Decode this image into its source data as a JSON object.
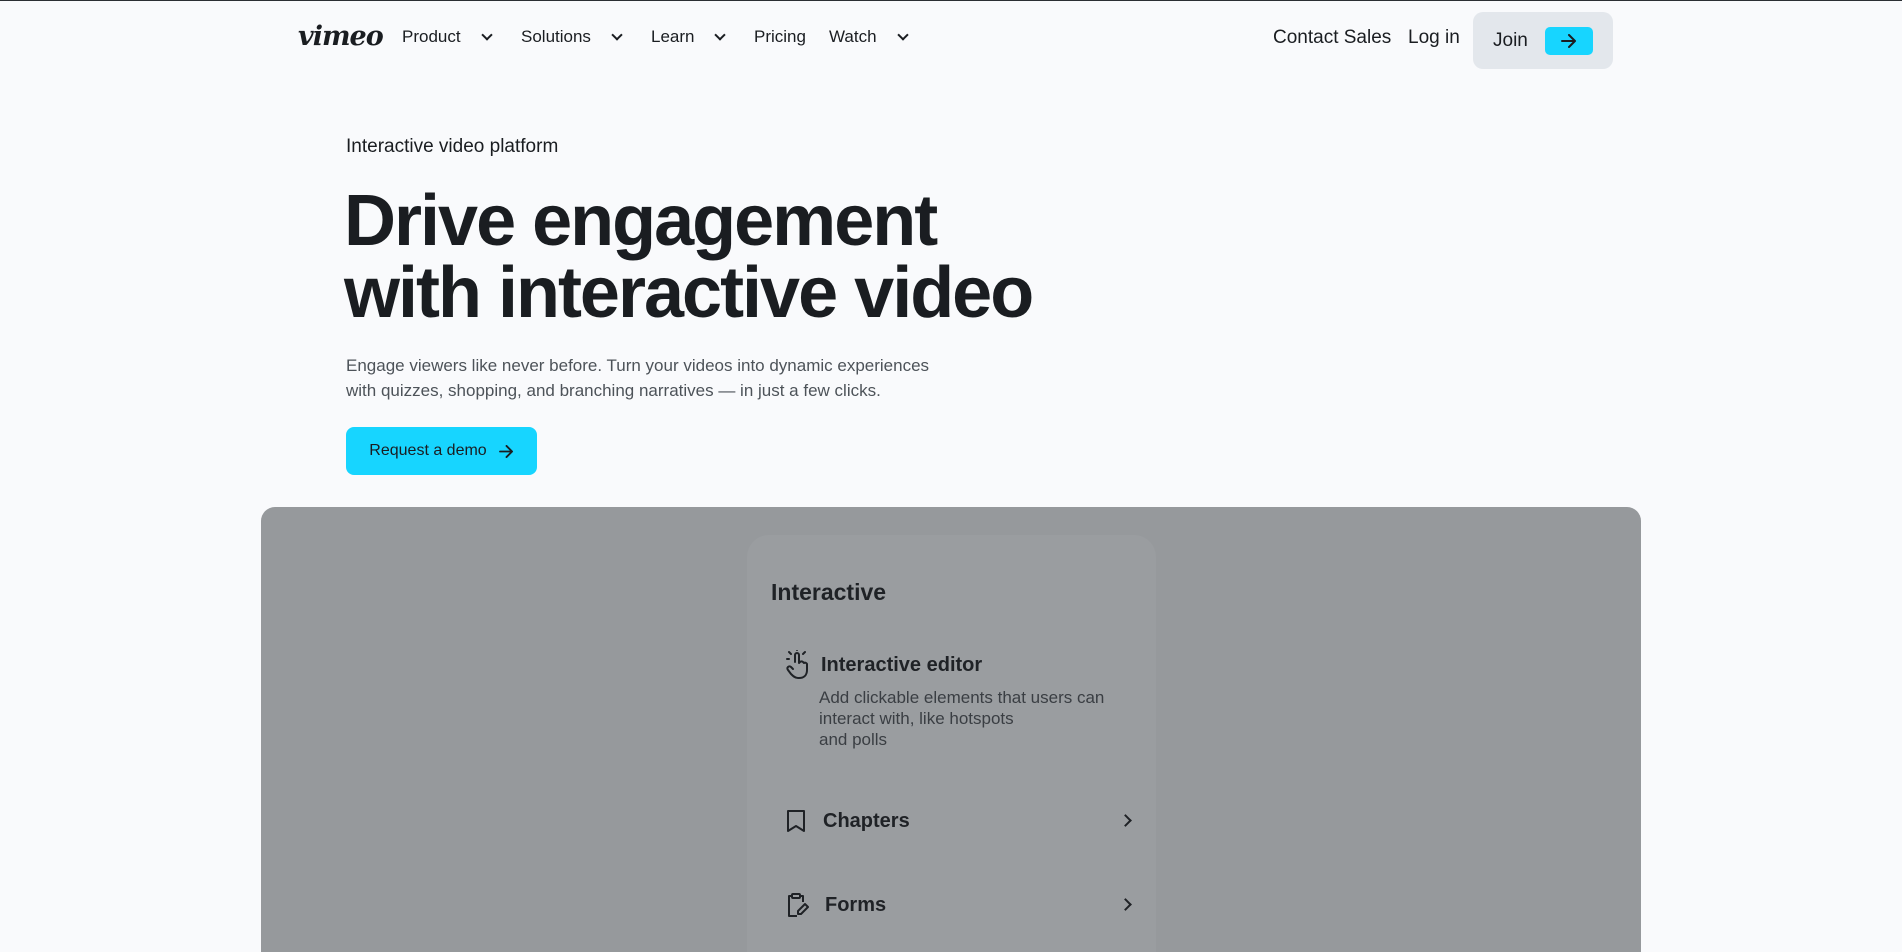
{
  "nav": {
    "logo": "vimeo",
    "items": [
      {
        "label": "Product",
        "has_menu": true
      },
      {
        "label": "Solutions",
        "has_menu": true
      },
      {
        "label": "Learn",
        "has_menu": true
      },
      {
        "label": "Pricing",
        "has_menu": false
      },
      {
        "label": "Watch",
        "has_menu": true
      }
    ],
    "contact_sales": "Contact Sales",
    "login": "Log in",
    "join": "Join"
  },
  "hero": {
    "eyebrow": "Interactive video platform",
    "headline_line1": "Drive engagement",
    "headline_line2": "with interactive video",
    "sub_line1": "Engage viewers like never before. Turn your videos into dynamic experiences",
    "sub_line2": "with quizzes, shopping, and branching narratives — in just a few clicks.",
    "cta": "Request a demo"
  },
  "panel": {
    "card_title": "Interactive",
    "feature": {
      "icon": "tap-hand-icon",
      "title": "Interactive editor",
      "desc_line1": "Add clickable elements that users can",
      "desc_line2": "interact with, like hotspots",
      "desc_line3": "and polls"
    },
    "rows": [
      {
        "icon": "bookmark-icon",
        "label": "Chapters"
      },
      {
        "icon": "clipboard-edit-icon",
        "label": "Forms"
      }
    ]
  },
  "colors": {
    "accent": "#17d5ff",
    "background": "#f9fafc",
    "text": "#1a1d21",
    "panel": "#96999c"
  }
}
